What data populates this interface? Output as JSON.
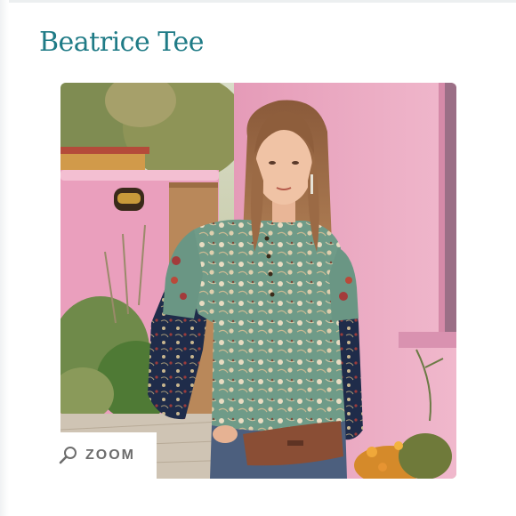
{
  "product": {
    "title": "Beatrice Tee"
  },
  "image": {
    "alt": "Model wearing the Beatrice Tee, a green floral top with navy embroidered sleeves, in front of a pink adobe wall"
  },
  "zoom": {
    "label": "ZOOM",
    "icon": "magnifier-icon"
  },
  "colors": {
    "title": "#1f7b86",
    "zoom_text": "#6d6d6d",
    "wall_pink": "#e9a7c0",
    "tee_green": "#6f9b88",
    "sleeve_navy": "#1f2c4a"
  }
}
